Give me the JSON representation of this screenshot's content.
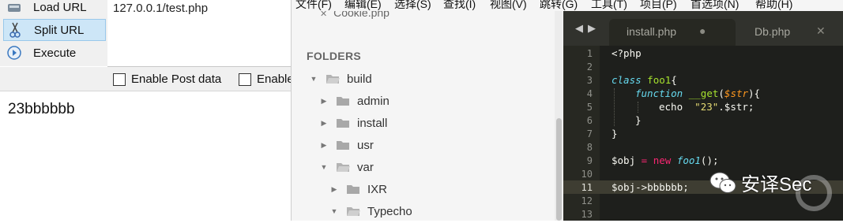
{
  "hackbar": {
    "buttons": [
      {
        "label": "Load URL",
        "icon": "load-url-icon"
      },
      {
        "label": "Split URL",
        "icon": "scissors-icon"
      },
      {
        "label": "Execute",
        "icon": "execute-icon"
      }
    ],
    "url_value": "127.0.0.1/test.php",
    "options": [
      {
        "label": "Enable Post data",
        "checked": false
      },
      {
        "label": "Enable",
        "checked": false
      }
    ]
  },
  "page_output": "23bbbbbb",
  "menubar": [
    "文件(F)",
    "编辑(E)",
    "选择(S)",
    "查找(I)",
    "视图(V)",
    "跳转(G)",
    "工具(T)",
    "项目(P)",
    "首选项(N)",
    "帮助(H)"
  ],
  "sidebar": {
    "open_file": "Cookie.php",
    "folders_header": "FOLDERS",
    "tree": [
      {
        "label": "build",
        "expanded": true
      },
      {
        "label": "admin",
        "expanded": false
      },
      {
        "label": "install",
        "expanded": false
      },
      {
        "label": "usr",
        "expanded": false
      },
      {
        "label": "var",
        "expanded": true
      },
      {
        "label": "IXR",
        "expanded": false
      },
      {
        "label": "Typecho",
        "expanded": true
      }
    ]
  },
  "editor": {
    "tabs": [
      {
        "label": "install.php",
        "active": true,
        "modified": true
      },
      {
        "label": "Db.php",
        "active": false,
        "modified": false
      }
    ],
    "line_numbers": [
      "1",
      "2",
      "3",
      "4",
      "5",
      "6",
      "7",
      "8",
      "9",
      "10",
      "11",
      "12",
      "13"
    ],
    "current_line": "11",
    "code": {
      "l1": "<?php",
      "l3_kw": "class",
      "l3_name": "foo1",
      "l3_brace": "{",
      "l4_kw": "function",
      "l4_name": "__get",
      "l4_open": "(",
      "l4_param": "$str",
      "l4_close": "){",
      "l5_echo": "echo",
      "l5_str": "\"23\"",
      "l5_rest": ".$str;",
      "l6": "}",
      "l7": "}",
      "l9_var": "$obj",
      "l9_eq": "=",
      "l9_new": "new",
      "l9_cls": "foo1",
      "l9_end": "();",
      "l11": "$obj->bbbbbb;"
    },
    "colors": {
      "background": "#272822",
      "keyword": "#f92672",
      "type": "#66d9ef",
      "function": "#a6e22e",
      "string": "#e6db74",
      "param": "#fd971f"
    }
  },
  "watermark": {
    "text": "安译Sec",
    "icon": "wechat-icon"
  }
}
